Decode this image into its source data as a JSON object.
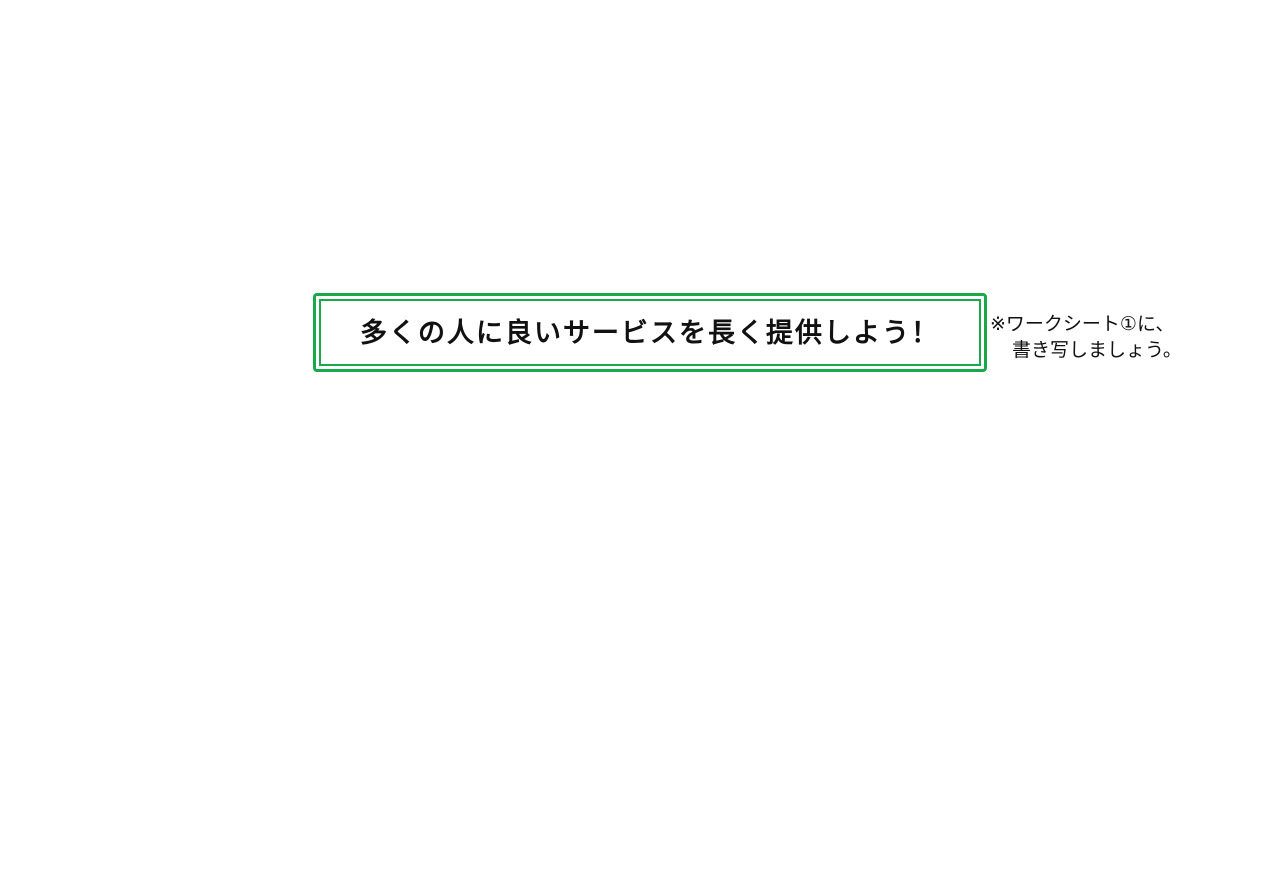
{
  "goal": {
    "text": "多くの人に良いサービスを長く提供しよう！",
    "border_color": "#19a84a"
  },
  "note": {
    "line1": "※ワークシート①に、",
    "line2": "書き写しましょう。"
  }
}
